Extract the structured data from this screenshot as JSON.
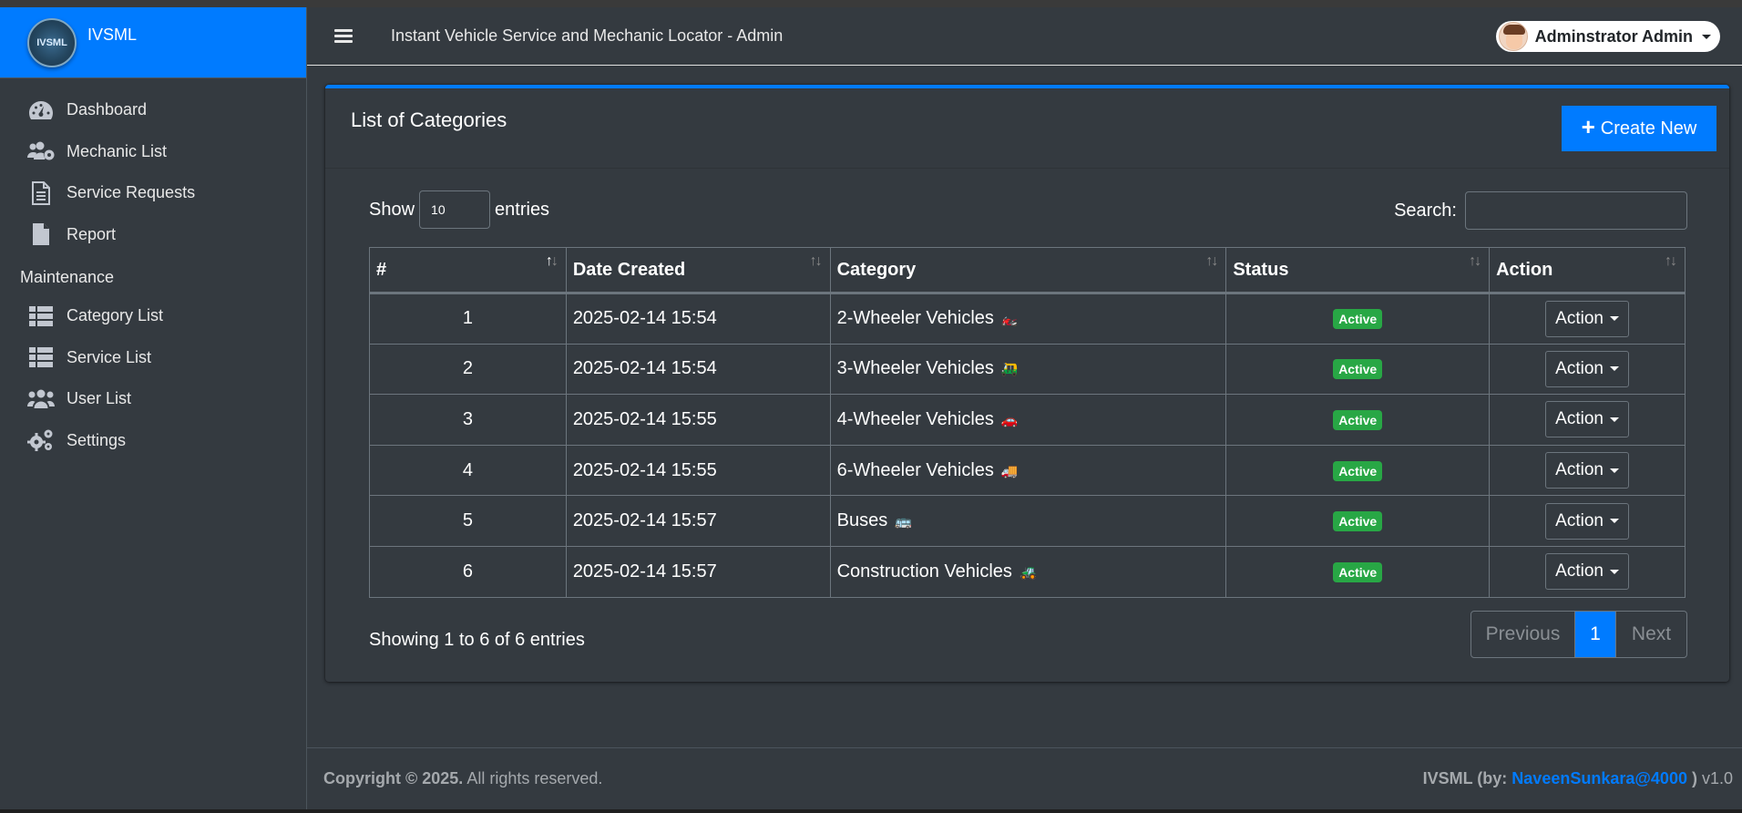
{
  "brand": {
    "name": "IVSML",
    "logo_text": "IVSML"
  },
  "header": {
    "title": "Instant Vehicle Service and Mechanic Locator - Admin",
    "user": "Adminstrator Admin"
  },
  "sidebar": {
    "items": [
      {
        "label": "Dashboard",
        "icon": "dashboard-icon"
      },
      {
        "label": "Mechanic List",
        "icon": "users-cog-icon"
      },
      {
        "label": "Service Requests",
        "icon": "file-alt-icon"
      },
      {
        "label": "Report",
        "icon": "file-icon"
      }
    ],
    "section": "Maintenance",
    "maintenance_items": [
      {
        "label": "Category List",
        "icon": "table-icon"
      },
      {
        "label": "Service List",
        "icon": "table-icon"
      },
      {
        "label": "User List",
        "icon": "users-icon"
      },
      {
        "label": "Settings",
        "icon": "cogs-icon"
      }
    ]
  },
  "card": {
    "title": "List of Categories",
    "create_label": "Create New",
    "show_label": "Show",
    "entries_value": "10",
    "entries_label": "entries",
    "search_label": "Search:",
    "columns": [
      "#",
      "Date Created",
      "Category",
      "Status",
      "Action"
    ],
    "rows": [
      {
        "num": "1",
        "date": "2025-02-14 15:54",
        "category": "2-Wheeler Vehicles",
        "emoji": "🏍️",
        "status": "Active",
        "action": "Action"
      },
      {
        "num": "2",
        "date": "2025-02-14 15:54",
        "category": "3-Wheeler Vehicles",
        "emoji": "🛺",
        "status": "Active",
        "action": "Action"
      },
      {
        "num": "3",
        "date": "2025-02-14 15:55",
        "category": "4-Wheeler Vehicles",
        "emoji": "🚗",
        "status": "Active",
        "action": "Action"
      },
      {
        "num": "4",
        "date": "2025-02-14 15:55",
        "category": "6-Wheeler Vehicles",
        "emoji": "🚚",
        "status": "Active",
        "action": "Action"
      },
      {
        "num": "5",
        "date": "2025-02-14 15:57",
        "category": "Buses",
        "emoji": "🚌",
        "status": "Active",
        "action": "Action"
      },
      {
        "num": "6",
        "date": "2025-02-14 15:57",
        "category": "Construction Vehicles",
        "emoji": "🚜",
        "status": "Active",
        "action": "Action"
      }
    ],
    "info": "Showing 1 to 6 of 6 entries",
    "pager": {
      "prev": "Previous",
      "page": "1",
      "next": "Next"
    }
  },
  "footer": {
    "copyright_bold": "Copyright © 2025.",
    "copyright_rest": " All rights reserved.",
    "credit_prefix": "IVSML (by: ",
    "credit_link": "NaveenSunkara@4000",
    "credit_suffix": " )",
    "version": " v1.0"
  },
  "colors": {
    "primary": "#007bff",
    "success": "#28a745",
    "background": "#343a40"
  }
}
